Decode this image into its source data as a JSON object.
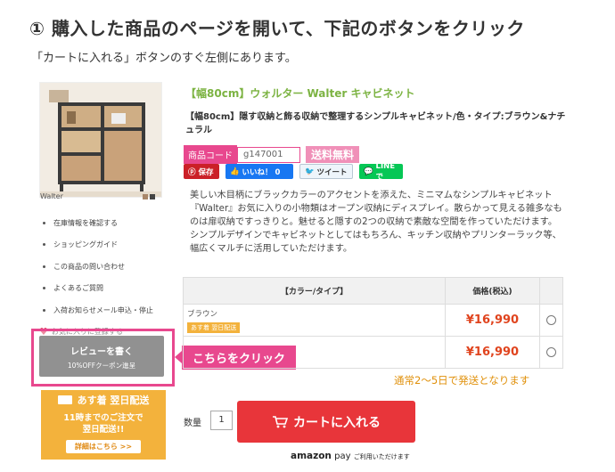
{
  "heading": "① 購入した商品のページを開いて、下記のボタンをクリック",
  "subheading": "「カートに入れる」ボタンのすぐ左側にあります。",
  "thumbnail": {
    "label": "Walter"
  },
  "side_links": [
    "在庫情報を確認する",
    "ショッピングガイド",
    "この商品の問い合わせ",
    "よくあるご質問",
    "入荷お知らせメール申込・停止",
    "お気に入りに登録する"
  ],
  "review_button": {
    "line1": "レビューを書く",
    "line2": "10%OFFクーポン進呈"
  },
  "callout": "こちらをクリック",
  "delivery_banner": {
    "top": "あす着 翌日配送",
    "line1": "11時までのご注文で",
    "line2": "翌日配送!!",
    "detail": "詳細はこちら >>"
  },
  "product": {
    "title": "【幅80cm】ウォルター Walter キャビネット",
    "description": "【幅80cm】隠す収納と飾る収納で整理するシンプルキャビネット/色・タイプ:ブラウン&ナチュラル",
    "code_label": "商品コード",
    "code_value": "g147001",
    "free_shipping": "送料無料",
    "long_description": "美しい木目柄にブラックカラーのアクセントを添えた、ミニマムなシンプルキャビネット『Walter』お気に入りの小物類はオープン収納にディスプレイ。散らかって見える雑多なものは扉収納ですっきりと。魅せると隠すの2つの収納で素敵な空間を作っていただけます。シンプルデザインでキャビネットとしてはもちろん、キッチン収納やプリンターラック等、幅広くマルチに活用していただけます。"
  },
  "social": {
    "pin": "保存",
    "fb": "いいね！ 0",
    "tw": "ツイート",
    "line": "LINEで"
  },
  "table": {
    "col_type": "【カラー/タイプ】",
    "col_price": "価格(税込)",
    "rows": [
      {
        "name": "ブラウン",
        "tag": "あす着 翌日配送",
        "price": "¥16,990"
      },
      {
        "name": "",
        "tag": "",
        "price": "¥16,990"
      }
    ]
  },
  "shipping_note": "通常2〜5日で発送となります",
  "quantity": {
    "label": "数量",
    "value": "1"
  },
  "cart_button": "カートに入れる",
  "amazon_pay": {
    "brand": "amazon",
    "suffix": "pay",
    "note": "ご利用いただけます"
  },
  "colors": {
    "accent_pink": "#e8488e",
    "cart_red": "#e8353a",
    "title_green": "#7cb342",
    "price_red": "#e0441e",
    "banner_orange": "#f3b23c"
  }
}
